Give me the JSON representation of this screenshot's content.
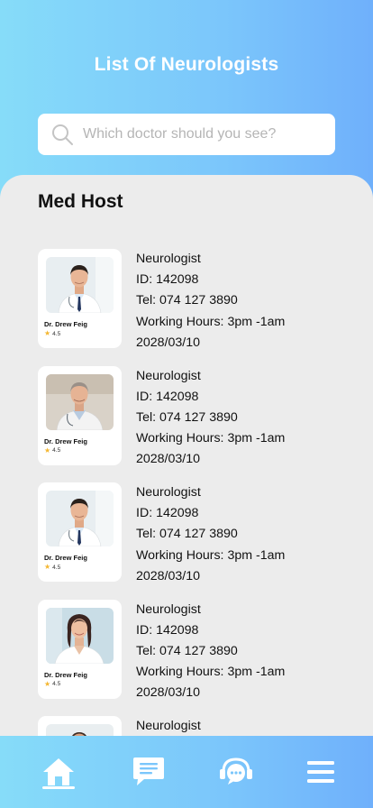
{
  "header": {
    "title": "List Of Neurologists"
  },
  "search": {
    "placeholder": "Which doctor should you see?",
    "icon": "search-icon"
  },
  "section": {
    "title": "Med Host"
  },
  "doctors": [
    {
      "name": "Dr. Drew Feig",
      "rating": "4.5",
      "specialty": "Neurologist",
      "id": "ID: 142098",
      "tel": "Tel: 074 127 3890",
      "hours": "Working Hours: 3pm -1am",
      "date": "2028/03/10"
    },
    {
      "name": "Dr. Drew Feig",
      "rating": "4.5",
      "specialty": "Neurologist",
      "id": "ID: 142098",
      "tel": "Tel: 074 127 3890",
      "hours": "Working Hours: 3pm -1am",
      "date": "2028/03/10"
    },
    {
      "name": "Dr. Drew Feig",
      "rating": "4.5",
      "specialty": "Neurologist",
      "id": "ID: 142098",
      "tel": "Tel: 074 127 3890",
      "hours": "Working Hours: 3pm -1am",
      "date": "2028/03/10"
    },
    {
      "name": "Dr. Drew Feig",
      "rating": "4.5",
      "specialty": "Neurologist",
      "id": "ID: 142098",
      "tel": "Tel: 074 127 3890",
      "hours": "Working Hours: 3pm -1am",
      "date": "2028/03/10"
    },
    {
      "name": "",
      "rating": "",
      "specialty": "Neurologist",
      "id": "",
      "tel": "",
      "hours": "",
      "date": ""
    }
  ],
  "tabbar": {
    "items": [
      {
        "icon": "home-icon",
        "active": true
      },
      {
        "icon": "chat-icon",
        "active": false
      },
      {
        "icon": "support-icon",
        "active": false
      },
      {
        "icon": "menu-icon",
        "active": false
      }
    ]
  },
  "colors": {
    "gradient_start": "#86dcf9",
    "gradient_end": "#6fb0fb",
    "panel": "#ececec",
    "star": "#f4b630"
  }
}
